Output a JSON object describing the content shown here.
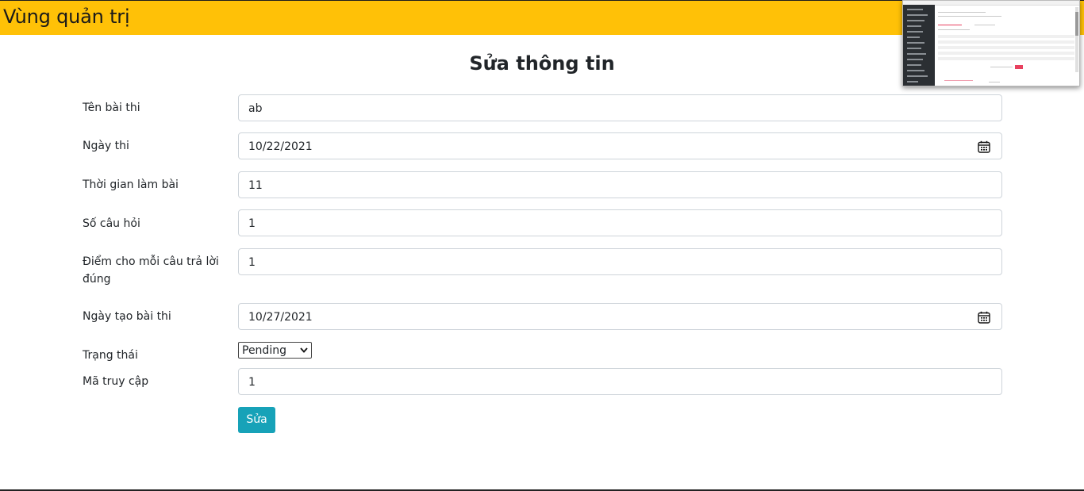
{
  "header": {
    "title": "Vùng quản trị",
    "background": "#ffc107"
  },
  "form": {
    "title": "Sửa thông tin",
    "fields": {
      "exam_name": {
        "label": "Tên bài thi",
        "value": "ab"
      },
      "exam_date": {
        "label": "Ngày thi",
        "value": "10/22/2021",
        "icon": "calendar-icon"
      },
      "duration": {
        "label": "Thời gian làm bài",
        "value": "11"
      },
      "question_count": {
        "label": "Số câu hỏi",
        "value": "1"
      },
      "points_per_answer": {
        "label": "Điểm cho mỗi câu trả lời đúng",
        "value": "1"
      },
      "created_date": {
        "label": "Ngày tạo bài thi",
        "value": "10/27/2021",
        "icon": "calendar-icon"
      },
      "status": {
        "label": "Trạng thái",
        "value": "Pending"
      },
      "access_code": {
        "label": "Mã truy cập",
        "value": "1"
      }
    },
    "submit_label": "Sửa",
    "submit_color": "#17a2b8"
  }
}
